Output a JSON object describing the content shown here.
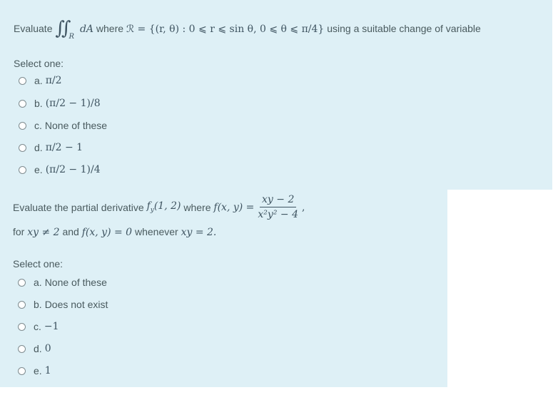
{
  "questions": [
    {
      "prefix": "Evaluate",
      "integral_symbol": "∬",
      "integral_region": "R",
      "integrand": "dA",
      "where": "where",
      "region_def": "ℛ = {(r, θ) : 0 ⩽ r ⩽ sin θ, 0 ⩽ θ ⩽ π/4}",
      "suffix": "using a suitable change of variable",
      "select_label": "Select one:",
      "options": [
        {
          "letter": "a.",
          "text": "π/2",
          "is_math": true
        },
        {
          "letter": "b.",
          "text": "(π/2 − 1)/8",
          "is_math": true
        },
        {
          "letter": "c.",
          "text": "None of these",
          "is_math": false
        },
        {
          "letter": "d.",
          "text": "π/2 − 1",
          "is_math": true
        },
        {
          "letter": "e.",
          "text": "(π/2 − 1)/4",
          "is_math": true
        }
      ]
    },
    {
      "line1_prefix": "Evaluate the partial derivative",
      "fy": "f_y(1, 2)",
      "where": "where",
      "f_def": "f(x, y) =",
      "numerator": "xy − 2",
      "denominator": "x²y² − 4",
      "comma": ",",
      "line2_for": "for",
      "cond1": "xy ≠ 2",
      "and": "and",
      "cond2": "f(x, y) = 0",
      "whenever": "whenever",
      "cond3": "xy = 2.",
      "select_label": "Select one:",
      "options": [
        {
          "letter": "a.",
          "text": "None of these",
          "is_math": false
        },
        {
          "letter": "b.",
          "text": "Does not exist",
          "is_math": false
        },
        {
          "letter": "c.",
          "text": "−1",
          "is_math": true
        },
        {
          "letter": "d.",
          "text": "0",
          "is_math": true
        },
        {
          "letter": "e.",
          "text": "1",
          "is_math": true
        }
      ]
    }
  ],
  "colors": {
    "panel_bg": "#def0f6",
    "text": "#495a5e",
    "math": "#3f5461"
  }
}
